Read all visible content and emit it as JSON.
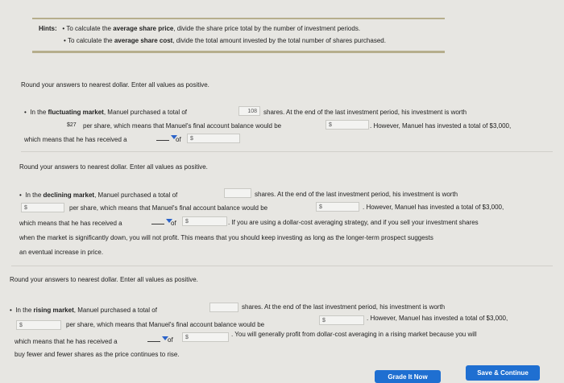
{
  "hints": {
    "label": "Hints:",
    "h1_pre": "To calculate the ",
    "h1_bold": "average share price",
    "h1_post": ", divide the share price total by the number of investment periods.",
    "h2_pre": "To calculate the ",
    "h2_bold": "average share cost",
    "h2_post": ", divide the total amount invested by the total number of shares purchased."
  },
  "round_instruction": "Round your answers to nearest dollar. Enter all values as positive.",
  "fluctuating": {
    "l1_pre": "In the ",
    "market": "fluctuating market",
    "l1_mid": ", Manuel purchased a total of",
    "shares_value": "108",
    "l1_post": "shares. At the end of the last investment period, his investment is worth",
    "price_value": "$27",
    "l2_mid": "per share, which means that Manuel's final account balance would be",
    "l2_post": ". However, Manuel has invested a total of $3,000,",
    "l3_pre": "which means that he has received a",
    "l3_mid": "of",
    "dollar": "$"
  },
  "declining": {
    "l1_pre": "In the ",
    "market": "declining market",
    "l1_mid": ", Manuel purchased a total of",
    "l1_post": "shares. At the end of the last investment period, his investment is worth",
    "l2_mid": "per share, which means that Manuel's final account balance would be",
    "l2_post": ". However, Manuel has invested a total of $3,000,",
    "l3_pre": "which means that he has received a",
    "l3_mid": "of",
    "l3_post": ". If you are using a dollar-cost averaging strategy, and if you sell your investment shares",
    "l4": "when the market is significantly down, you will not profit. This means that you should keep investing as long as the longer-term prospect suggests",
    "l5": "an eventual increase in price.",
    "dollar": "$"
  },
  "rising": {
    "l1_pre": "In the ",
    "market": "rising market",
    "l1_mid": ", Manuel purchased a total of",
    "l1_post": "shares. At the end of the last investment period, his investment is worth",
    "l2_mid": "per share, which means that Manuel's final account balance would be",
    "l2_post": ". However, Manuel has invested a total of $3,000,",
    "l3_pre": "which means that he has received a",
    "l3_mid": "of",
    "l3_post": ". You will generally profit from dollar-cost averaging in a rising market because you will",
    "l4": "buy fewer and fewer shares as the price continues to rise.",
    "dollar": "$"
  },
  "buttons": {
    "grade": "Grade It Now",
    "save": "Save & Continue"
  },
  "colors": {
    "primary_button": "#1f6fd1",
    "dropdown_arrow": "#2b63c9",
    "rule": "#b6ae8c"
  }
}
